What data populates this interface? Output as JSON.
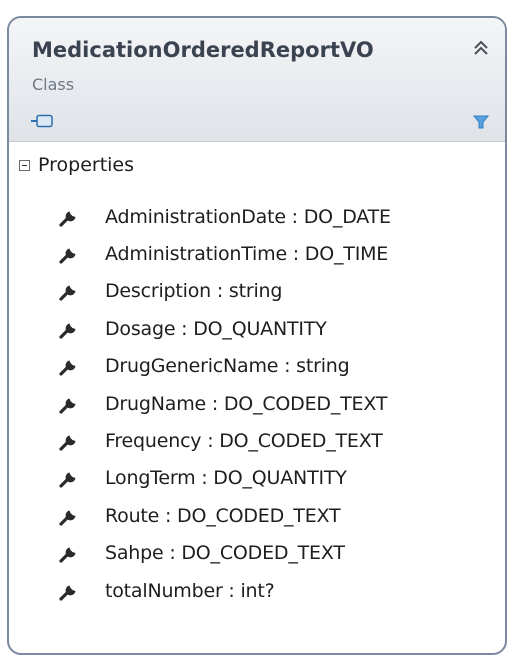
{
  "class": {
    "name": "MedicationOrderedReportVO",
    "stereotype": "Class"
  },
  "compartment": {
    "title": "Properties",
    "expanded": true
  },
  "properties": [
    {
      "text": "AdministrationDate : DO_DATE",
      "icon": "wrench-property-icon"
    },
    {
      "text": "AdministrationTime : DO_TIME",
      "icon": "wrench-property-icon"
    },
    {
      "text": "Description : string",
      "icon": "wrench-property-icon"
    },
    {
      "text": "Dosage : DO_QUANTITY",
      "icon": "wrench-property-icon"
    },
    {
      "text": "DrugGenericName : string",
      "icon": "wrench-property-icon"
    },
    {
      "text": "DrugName : DO_CODED_TEXT",
      "icon": "wrench-property-icon"
    },
    {
      "text": "Frequency : DO_CODED_TEXT",
      "icon": "wrench-property-icon"
    },
    {
      "text": "LongTerm : DO_QUANTITY",
      "icon": "wrench-property-icon"
    },
    {
      "text": "Route : DO_CODED_TEXT",
      "icon": "wrench-property-icon"
    },
    {
      "text": "Sahpe : DO_CODED_TEXT",
      "icon": "wrench-property-icon"
    },
    {
      "text": "totalNumber : int?",
      "icon": "wrench-property-icon"
    }
  ],
  "colors": {
    "border": "#7b8aa0",
    "header_bg": "#e8ebef",
    "title_text": "#3b4250",
    "stereotype_text": "#707784",
    "filter_icon": "#2a7fc8"
  }
}
